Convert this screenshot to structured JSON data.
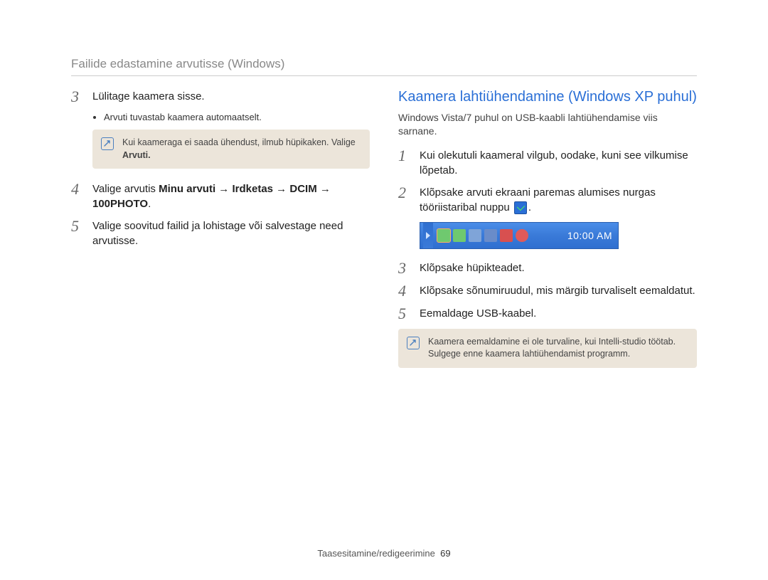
{
  "header": {
    "title": "Failide edastamine arvutisse (Windows)"
  },
  "left": {
    "step3": {
      "num": "3",
      "text": "Lülitage kaamera sisse.",
      "bullet": "Arvuti tuvastab kaamera automaatselt."
    },
    "note1": {
      "text_a": "Kui kaameraga ei saada ühendust, ilmub hüpikaken. Valige ",
      "text_b": "Arvuti."
    },
    "step4": {
      "num": "4",
      "text_a": "Valige arvutis ",
      "bold1": "Minu arvuti",
      "arrow1": " → ",
      "bold2": "Irdketas",
      "arrow2": " → ",
      "bold3": "DCIM",
      "arrow3": " → ",
      "bold4": "100PHOTO",
      "tail": "."
    },
    "step5": {
      "num": "5",
      "text": "Valige soovitud failid ja lohistage või salvestage need arvutisse."
    }
  },
  "right": {
    "heading": "Kaamera lahtiühendamine (Windows XP puhul)",
    "intro": "Windows Vista/7 puhul on USB-kaabli lahtiühendamise viis sarnane.",
    "step1": {
      "num": "1",
      "text": "Kui olekutuli kaameral vilgub, oodake, kuni see vilkumise lõpetab."
    },
    "step2": {
      "num": "2",
      "text_a": "Klõpsake arvuti ekraani paremas alumises nurgas tööriistaribal nuppu ",
      "text_b": "."
    },
    "taskbar_time": "10:00 AM",
    "step3": {
      "num": "3",
      "text": "Klõpsake hüpikteadet."
    },
    "step4": {
      "num": "4",
      "text": "Klõpsake sõnumiruudul, mis märgib turvaliselt eemaldatut."
    },
    "step5": {
      "num": "5",
      "text": "Eemaldage USB-kaabel."
    },
    "note2": "Kaamera eemaldamine ei ole turvaline, kui Intelli-studio töötab. Sulgege enne kaamera lahtiühendamist programm."
  },
  "footer": {
    "label": "Taasesitamine/redigeerimine",
    "page": "69"
  }
}
